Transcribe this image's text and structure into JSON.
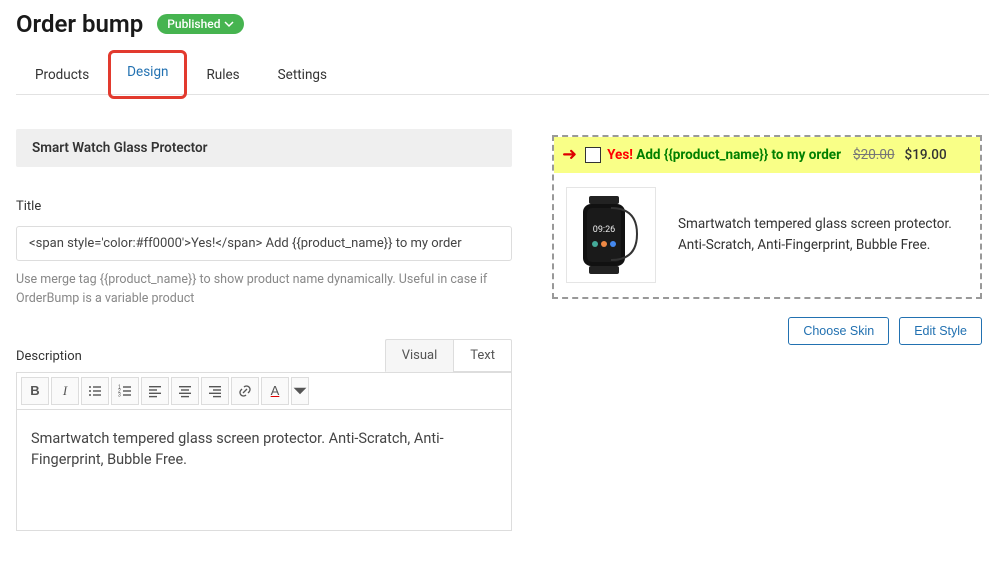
{
  "header": {
    "title": "Order bump",
    "status": "Published"
  },
  "tabs": [
    {
      "label": "Products",
      "active": false
    },
    {
      "label": "Design",
      "active": true
    },
    {
      "label": "Rules",
      "active": false
    },
    {
      "label": "Settings",
      "active": false
    }
  ],
  "product": {
    "name": "Smart Watch Glass Protector"
  },
  "title_field": {
    "label": "Title",
    "value": "<span style='color:#ff0000'>Yes!</span> Add {{product_name}} to my order",
    "help": "Use merge tag {{product_name}} to show product name dynamically. Useful in case if OrderBump is a variable product"
  },
  "description_field": {
    "label": "Description",
    "editor_tabs": {
      "visual": "Visual",
      "text": "Text"
    },
    "content": "Smartwatch tempered glass screen protector. Anti-Scratch, Anti-Fingerprint, Bubble Free."
  },
  "preview": {
    "yes": "Yes!",
    "add_text": "Add {{product_name}} to my order",
    "price_old": "$20.00",
    "price_new": "$19.00",
    "description": "Smartwatch tempered glass screen protector. Anti-Scratch, Anti-Fingerprint, Bubble Free."
  },
  "actions": {
    "choose_skin": "Choose Skin",
    "edit_style": "Edit Style"
  }
}
